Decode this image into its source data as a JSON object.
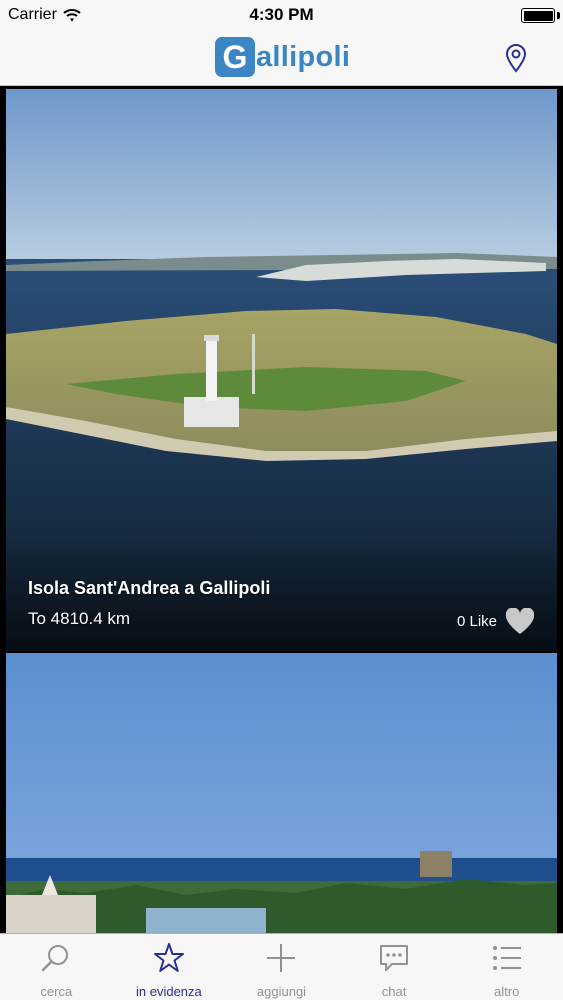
{
  "status_bar": {
    "carrier": "Carrier",
    "time": "4:30 PM",
    "icons": [
      "wifi-icon",
      "battery-icon"
    ]
  },
  "nav": {
    "logo_letter": "G",
    "logo_text": "allipoli",
    "right_icon": "map-pin-icon",
    "accent": "#3a86c5"
  },
  "feed": {
    "items": [
      {
        "title": "Isola Sant'Andrea a Gallipoli",
        "distance": "To 4810.4 km",
        "likes": "0 Like",
        "like_icon": "heart-icon"
      },
      {
        "title": "",
        "distance": "",
        "likes": ""
      }
    ]
  },
  "tabs": [
    {
      "label": "cerca",
      "icon": "search-icon",
      "active": false
    },
    {
      "label": "in evidenza",
      "icon": "star-icon",
      "active": true
    },
    {
      "label": "aggiungi",
      "icon": "plus-icon",
      "active": false
    },
    {
      "label": "chat",
      "icon": "chat-icon",
      "active": false
    },
    {
      "label": "altro",
      "icon": "list-icon",
      "active": false
    }
  ],
  "colors": {
    "active_tab": "#2b2f92",
    "inactive_tab": "#929292",
    "bar_background": "#f7f7f7"
  }
}
